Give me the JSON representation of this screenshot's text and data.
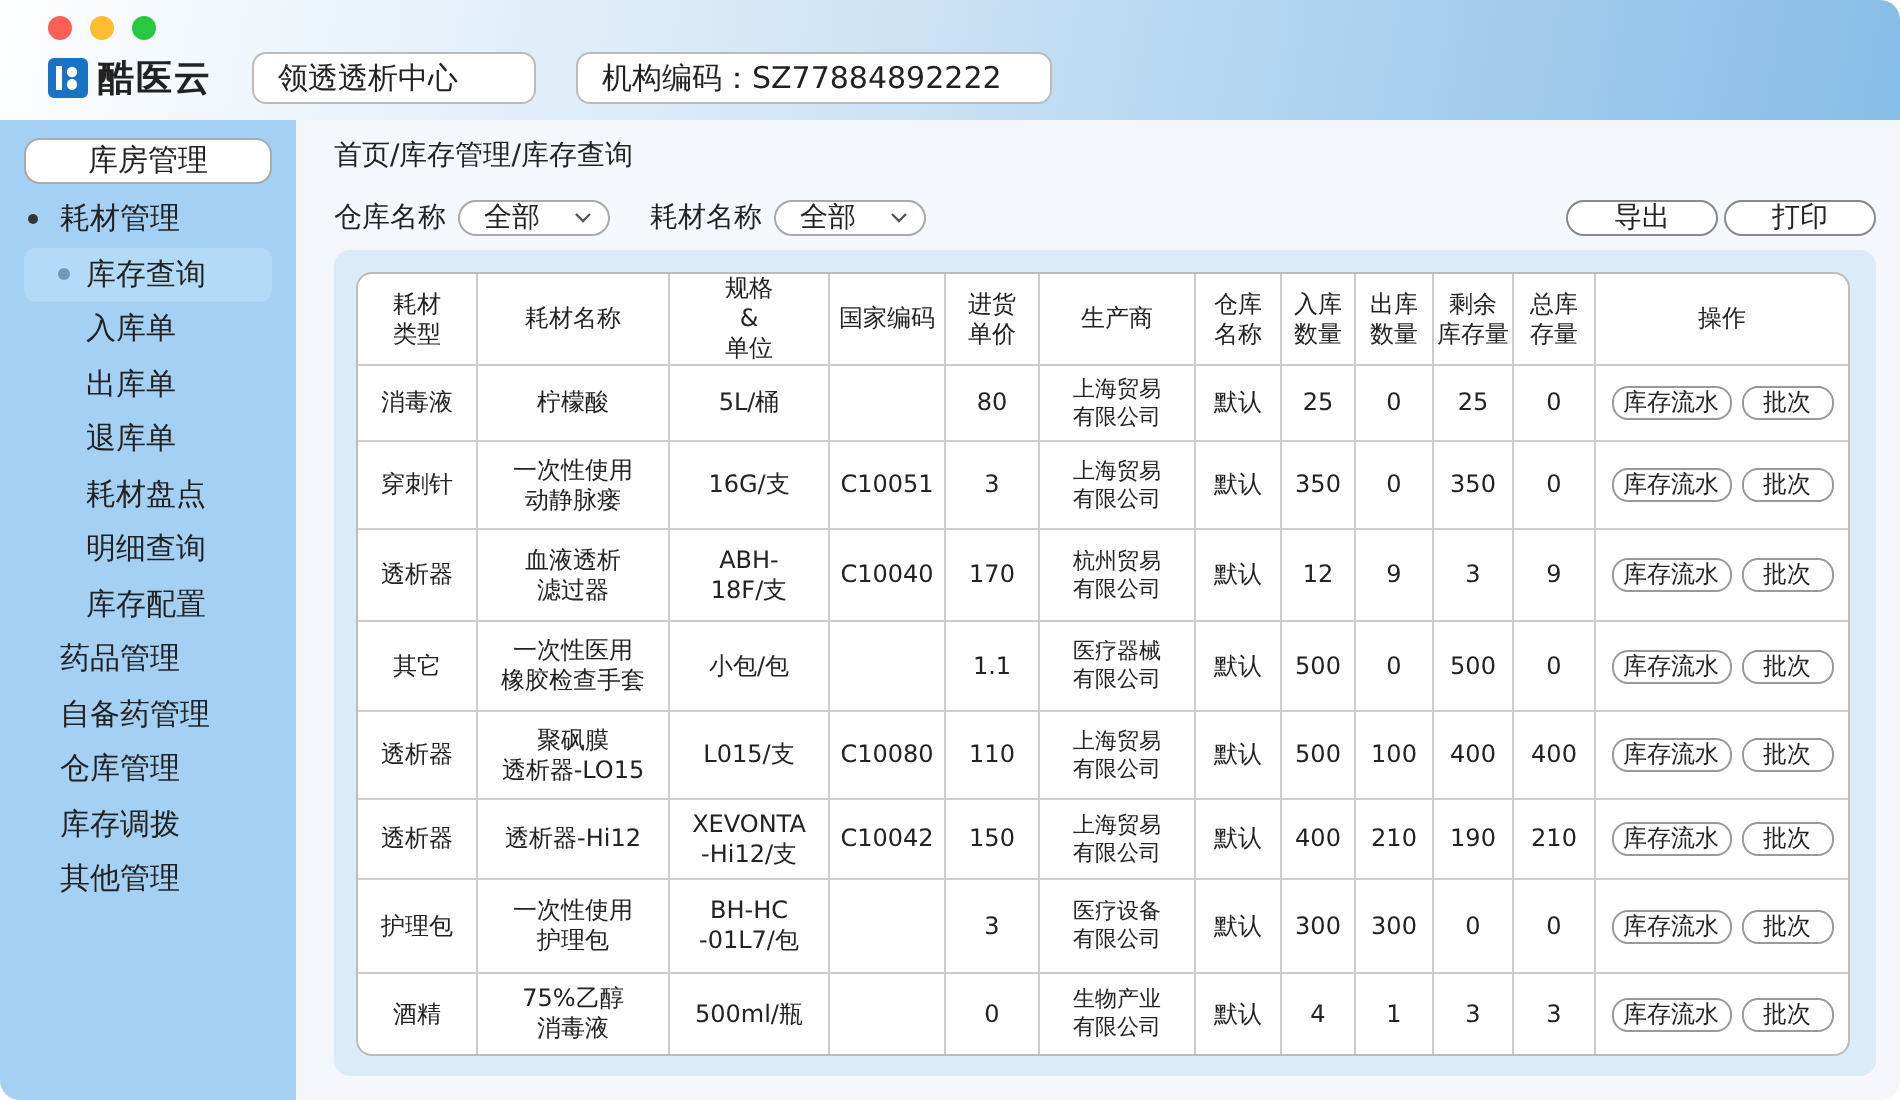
{
  "brand": {
    "name": "酷医云"
  },
  "header": {
    "org": "领透透析中心",
    "org_code": "机构编码：SZ77884892222"
  },
  "sidebar": {
    "title": "库房管理",
    "items": [
      {
        "label": "耗材管理",
        "expanded": true,
        "selected": false,
        "children": [
          {
            "label": "库存查询",
            "selected": true
          },
          {
            "label": "入库单",
            "selected": false
          },
          {
            "label": "出库单",
            "selected": false
          },
          {
            "label": "退库单",
            "selected": false
          },
          {
            "label": "耗材盘点",
            "selected": false
          },
          {
            "label": "明细查询",
            "selected": false
          },
          {
            "label": "库存配置",
            "selected": false
          }
        ]
      },
      {
        "label": "药品管理",
        "expanded": false,
        "selected": false
      },
      {
        "label": "自备药管理",
        "expanded": false,
        "selected": false
      },
      {
        "label": "仓库管理",
        "expanded": false,
        "selected": false
      },
      {
        "label": "库存调拨",
        "expanded": false,
        "selected": false
      },
      {
        "label": "其他管理",
        "expanded": false,
        "selected": false
      }
    ]
  },
  "breadcrumb": "首页/库存管理/库存查询",
  "filters": [
    {
      "label": "仓库名称",
      "value": "全部"
    },
    {
      "label": "耗材名称",
      "value": "全部"
    }
  ],
  "actions": [
    "导出",
    "打印"
  ],
  "table": {
    "columns": [
      [
        "耗材",
        "类型"
      ],
      "耗材名称",
      [
        "规格",
        "&",
        "单位"
      ],
      "国家编码",
      [
        "进货",
        "单价"
      ],
      "生产商",
      [
        "仓库",
        "名称"
      ],
      [
        "入库",
        "数量"
      ],
      [
        "出库",
        "数量"
      ],
      [
        "剩余",
        "库存量"
      ],
      [
        "总库",
        "存量"
      ],
      "操作"
    ],
    "rows": [
      {
        "cells": [
          "消毒液",
          "柠檬酸",
          "5L/桶",
          "",
          "80",
          [
            "上海贸易",
            "有限公司"
          ],
          "默认",
          "25",
          "0",
          "25",
          "0"
        ],
        "actions": [
          "库存流水",
          "批次"
        ]
      },
      {
        "cells": [
          "穿刺针",
          [
            "一次性使用",
            "动静脉瘘"
          ],
          "16G/支",
          "C10051",
          "3",
          [
            "上海贸易",
            "有限公司"
          ],
          "默认",
          "350",
          "0",
          "350",
          "0"
        ],
        "actions": [
          "库存流水",
          "批次"
        ]
      },
      {
        "cells": [
          "透析器",
          [
            "血液透析",
            "滤过器"
          ],
          [
            "ABH-",
            "18F/支"
          ],
          "C10040",
          "170",
          [
            "杭州贸易",
            "有限公司"
          ],
          "默认",
          "12",
          "9",
          "3",
          "9"
        ],
        "actions": [
          "库存流水",
          "批次"
        ]
      },
      {
        "cells": [
          "其它",
          [
            "一次性医用",
            "橡胶检查手套"
          ],
          "小包/包",
          "",
          "1.1",
          [
            "医疗器械",
            "有限公司"
          ],
          "默认",
          "500",
          "0",
          "500",
          "0"
        ],
        "actions": [
          "库存流水",
          "批次"
        ]
      },
      {
        "cells": [
          "透析器",
          [
            "聚砜膜",
            "透析器-LO15"
          ],
          "L015/支",
          "C10080",
          "110",
          [
            "上海贸易",
            "有限公司"
          ],
          "默认",
          "500",
          "100",
          "400",
          "400"
        ],
        "actions": [
          "库存流水",
          "批次"
        ]
      },
      {
        "cells": [
          "透析器",
          "透析器-Hi12",
          [
            "XEVONTA",
            "-Hi12/支"
          ],
          "C10042",
          "150",
          [
            "上海贸易",
            "有限公司"
          ],
          "默认",
          "400",
          "210",
          "190",
          "210"
        ],
        "actions": [
          "库存流水",
          "批次"
        ]
      },
      {
        "cells": [
          "护理包",
          [
            "一次性使用",
            "护理包"
          ],
          [
            "BH-HC",
            "-01L7/包"
          ],
          "",
          "3",
          [
            "医疗设备",
            "有限公司"
          ],
          "默认",
          "300",
          "300",
          "0",
          "0"
        ],
        "actions": [
          "库存流水",
          "批次"
        ]
      },
      {
        "cells": [
          "酒精",
          [
            "75%乙醇",
            "消毒液"
          ],
          "500ml/瓶",
          "",
          "0",
          [
            "生物产业",
            "有限公司"
          ],
          "默认",
          "4",
          "1",
          "3",
          "3"
        ],
        "actions": [
          "库存流水",
          "批次"
        ]
      }
    ]
  }
}
